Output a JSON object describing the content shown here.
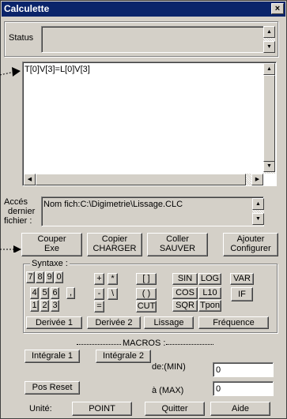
{
  "window": {
    "title": "Calculette",
    "close_glyph": "×"
  },
  "status": {
    "label": "Status",
    "value": ""
  },
  "editor": {
    "text": "T[0]V[3]=L[0]V[3]"
  },
  "file": {
    "label_line1": "Accés",
    "label_line2": "dernier",
    "label_line3": "fichier :",
    "path": "Nom fich:C:\\Digimetrie\\Lissage.CLC"
  },
  "file_buttons": [
    {
      "top": "Couper",
      "bottom": "Exe"
    },
    {
      "top": "Copier",
      "bottom": "CHARGER"
    },
    {
      "top": "Coller",
      "bottom": "SAUVER"
    },
    {
      "top": "Ajouter",
      "bottom": "Configurer"
    }
  ],
  "syntax": {
    "title": "Syntaxe :",
    "digits_row1": [
      "7",
      "8",
      "9",
      "0"
    ],
    "digits_row2": [
      "4",
      "5",
      "6",
      ","
    ],
    "digits_row3": [
      "1",
      "2",
      "3"
    ],
    "ops": {
      "plus": "+",
      "times": "*",
      "minus": "-",
      "backslash": "\\",
      "equals": "="
    },
    "brackets": "[ ]",
    "parens": "( )",
    "cut": "CUT",
    "sin": "SIN",
    "log": "LOG",
    "var": "VAR",
    "cos": "COS",
    "l10": "L10",
    "if": "IF",
    "sqr": "SQR",
    "tpon": "Tpon",
    "derivee1": "Derivée 1",
    "derivee2": "Derivée 2",
    "lissage": "Lissage",
    "frequence": "Fréquence"
  },
  "macros": {
    "title": "MACROS :",
    "integrale1": "Intégrale 1",
    "integrale2": "Intégrale 2",
    "de_min_label": "de:(MIN)",
    "de_min_value": "0",
    "pos_reset": "Pos Reset",
    "a_max_label": "à (MAX)",
    "a_max_value": "0"
  },
  "footer": {
    "unite_label": "Unité:",
    "point": "POINT",
    "quitter": "Quitter",
    "aide": "Aide"
  },
  "scroll_glyphs": {
    "up": "▲",
    "down": "▼",
    "left": "◀",
    "right": "▶"
  }
}
